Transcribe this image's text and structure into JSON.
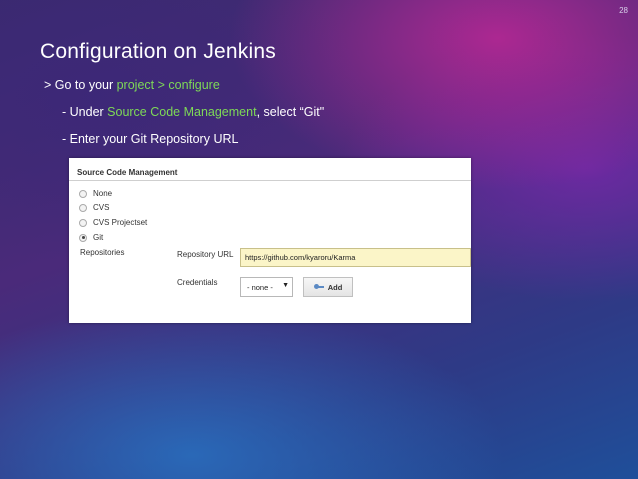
{
  "slide_number": "28",
  "title": "Configuration on Jenkins",
  "bullets": {
    "b1_prefix": "> Go to your ",
    "b1_highlight": "project > configure",
    "b2_prefix": "- Under ",
    "b2_highlight": "Source Code Management",
    "b2_suffix": ", select “Git\"",
    "b3": "- Enter your Git Repository URL"
  },
  "highlight_color": "#7ed957",
  "scm_panel": {
    "title": "Source Code Management",
    "options": [
      "None",
      "CVS",
      "CVS Projectset",
      "Git"
    ],
    "selected": "Git",
    "repositories_label": "Repositories",
    "repo_url_label": "Repository URL",
    "repo_url_value": "https://github.com/kyaroru/Karma",
    "credentials_label": "Credentials",
    "credentials_value": "- none -",
    "add_button_label": "Add"
  }
}
